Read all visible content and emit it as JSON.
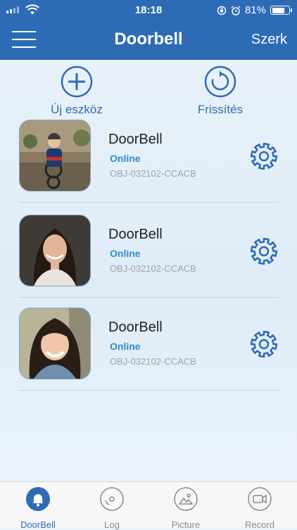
{
  "status_bar": {
    "time": "18:18",
    "battery": "81%",
    "battery_level": 0.81
  },
  "nav": {
    "title": "Doorbell",
    "edit_label": "Szerk"
  },
  "actions": {
    "add_label": "Új eszköz",
    "refresh_label": "Frissítés"
  },
  "devices": [
    {
      "name": "DoorBell",
      "status": "Online",
      "uid": "OBJ-032102-CCACB",
      "photo": "boy-on-bike"
    },
    {
      "name": "DoorBell",
      "status": "Online",
      "uid": "OBJ-032102-CCACB",
      "photo": "woman-portrait"
    },
    {
      "name": "DoorBell",
      "status": "Online",
      "uid": "OBJ-032102-CCACB",
      "photo": "girl-portrait"
    }
  ],
  "tabs": [
    {
      "label": "DoorBell",
      "icon": "bell-icon",
      "active": true
    },
    {
      "label": "Log",
      "icon": "disc-icon",
      "active": false
    },
    {
      "label": "Picture",
      "icon": "image-icon",
      "active": false
    },
    {
      "label": "Record",
      "icon": "video-icon",
      "active": false
    }
  ],
  "colors": {
    "accent": "#2d6bb5",
    "online": "#2f8bd0"
  }
}
